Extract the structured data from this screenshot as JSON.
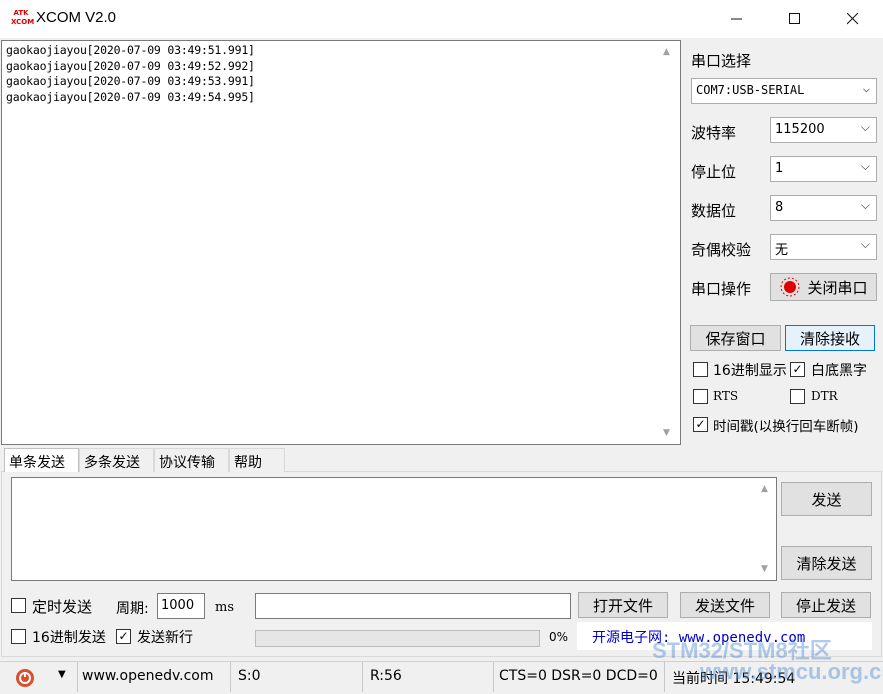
{
  "window": {
    "logo_text": "ATK XCOM",
    "title": "XCOM V2.0"
  },
  "receive": {
    "lines": [
      "gaokaojiayou[2020-07-09 03:49:51.991]",
      "gaokaojiayou[2020-07-09 03:49:52.992]",
      "gaokaojiayou[2020-07-09 03:49:53.991]",
      "gaokaojiayou[2020-07-09 03:49:54.995]"
    ]
  },
  "settings": {
    "port_label": "串口选择",
    "port_value": "COM7:USB-SERIAL",
    "baud_label": "波特率",
    "baud_value": "115200",
    "stop_label": "停止位",
    "stop_value": "1",
    "data_label": "数据位",
    "data_value": "8",
    "parity_label": "奇偶校验",
    "parity_value": "无",
    "op_label": "串口操作",
    "op_button": "关闭串口"
  },
  "actions": {
    "save_window": "保存窗口",
    "clear_receive": "清除接收"
  },
  "options": {
    "hex_display": {
      "label": "16进制显示",
      "checked": false
    },
    "white_black": {
      "label": "白底黑字",
      "checked": true
    },
    "rts": {
      "label": "RTS",
      "checked": false
    },
    "dtr": {
      "label": "DTR",
      "checked": false
    },
    "timestamp": {
      "label": "时间戳(以换行回车断帧)",
      "checked": true
    }
  },
  "tabs": [
    "单条发送",
    "多条发送",
    "协议传输",
    "帮助"
  ],
  "send": {
    "send_button": "发送",
    "clear_send_button": "清除发送",
    "timed_send_label": "定时发送",
    "period_label": "周期:",
    "period_value": "1000",
    "period_unit": "ms",
    "open_file": "打开文件",
    "send_file": "发送文件",
    "stop_send": "停止发送",
    "hex_send_label": "16进制发送",
    "newline_label": "发送新行",
    "progress_text": "0%",
    "progress": 0,
    "banner": "开源电子网: www.openedv.com"
  },
  "status": {
    "url": "www.openedv.com",
    "sent": "S:0",
    "received": "R:56",
    "lines": "CTS=0 DSR=0 DCD=0",
    "time": "当前时间 15:49:54"
  },
  "watermark": [
    "STM32/STM8社区",
    "www.stmcu.org.cn"
  ],
  "colors": {
    "accent_border": "#0078d7",
    "status_red": "#e00000"
  }
}
